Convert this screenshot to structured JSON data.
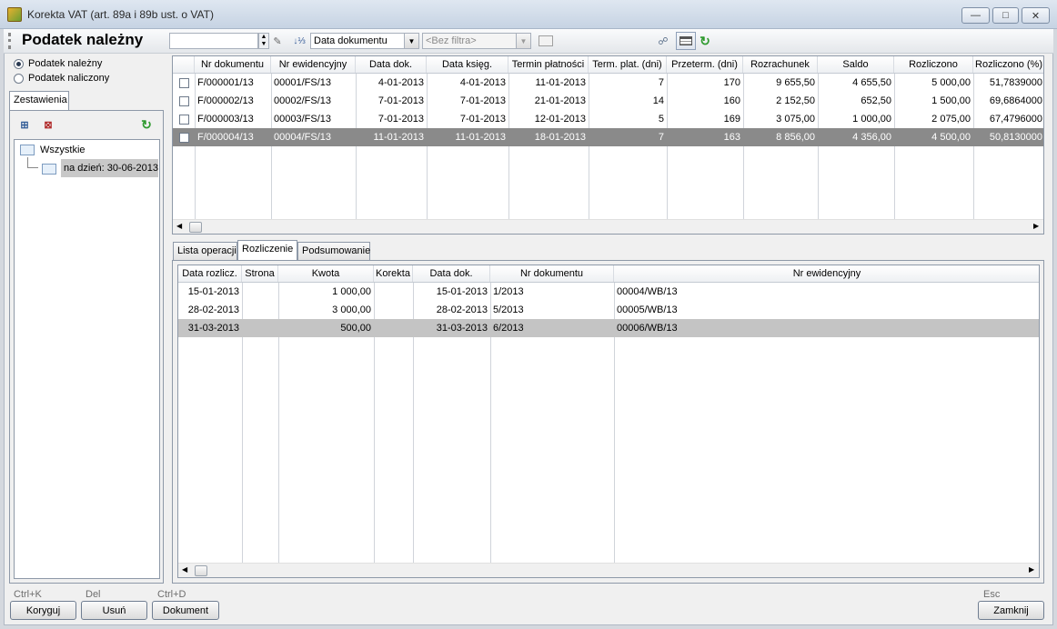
{
  "window": {
    "title": "Korekta VAT (art. 89a i 89b ust. o VAT)"
  },
  "toolbar": {
    "page_title": "Podatek należny",
    "sort_field": "Data dokumentu",
    "filter_placeholder": "<Bez filtra>"
  },
  "left": {
    "radios": [
      {
        "label": "Podatek należny",
        "checked": true
      },
      {
        "label": "Podatek naliczony",
        "checked": false
      }
    ],
    "tab_label": "Zestawienia",
    "tree": {
      "root": "Wszystkie",
      "child": "na dzień: 30-06-2013"
    }
  },
  "top_grid": {
    "headers": [
      "Nr dokumentu",
      "Nr ewidencyjny",
      "Data dok.",
      "Data księg.",
      "Termin płatności",
      "Term. plat. (dni)",
      "Przeterm. (dni)",
      "Rozrachunek",
      "Saldo",
      "Rozliczono",
      "Rozliczono (%)"
    ],
    "rows": [
      {
        "cells": [
          "F/000001/13",
          "00001/FS/13",
          "4-01-2013",
          "4-01-2013",
          "11-01-2013",
          "7",
          "170",
          "9 655,50",
          "4 655,50",
          "5 000,00",
          "51,7839000"
        ],
        "selected": false
      },
      {
        "cells": [
          "F/000002/13",
          "00002/FS/13",
          "7-01-2013",
          "7-01-2013",
          "21-01-2013",
          "14",
          "160",
          "2 152,50",
          "652,50",
          "1 500,00",
          "69,6864000"
        ],
        "selected": false
      },
      {
        "cells": [
          "F/000003/13",
          "00003/FS/13",
          "7-01-2013",
          "7-01-2013",
          "12-01-2013",
          "5",
          "169",
          "3 075,00",
          "1 000,00",
          "2 075,00",
          "67,4796000"
        ],
        "selected": false
      },
      {
        "cells": [
          "F/000004/13",
          "00004/FS/13",
          "11-01-2013",
          "11-01-2013",
          "18-01-2013",
          "7",
          "163",
          "8 856,00",
          "4 356,00",
          "4 500,00",
          "50,8130000"
        ],
        "selected": true
      }
    ]
  },
  "bottom_tabs": [
    {
      "label": "Lista operacji",
      "active": false
    },
    {
      "label": "Rozliczenie",
      "active": true
    },
    {
      "label": "Podsumowanie",
      "active": false
    }
  ],
  "bottom_grid": {
    "headers": [
      "Data rozlicz.",
      "Strona",
      "Kwota",
      "Korekta",
      "Data dok.",
      "Nr dokumentu",
      "Nr ewidencyjny"
    ],
    "rows": [
      {
        "cells": [
          "15-01-2013",
          "",
          "1 000,00",
          "",
          "15-01-2013",
          "1/2013",
          "00004/WB/13"
        ],
        "selected": false
      },
      {
        "cells": [
          "28-02-2013",
          "",
          "3 000,00",
          "",
          "28-02-2013",
          "5/2013",
          "00005/WB/13"
        ],
        "selected": false
      },
      {
        "cells": [
          "31-03-2013",
          "",
          "500,00",
          "",
          "31-03-2013",
          "6/2013",
          "00006/WB/13"
        ],
        "selected": true
      }
    ]
  },
  "footer": {
    "buttons": [
      {
        "label": "Koryguj",
        "shortcut": "Ctrl+K"
      },
      {
        "label": "Usuń",
        "shortcut": "Del"
      },
      {
        "label": "Dokument",
        "shortcut": "Ctrl+D"
      }
    ],
    "close": {
      "label": "Zamknij",
      "shortcut": "Esc"
    }
  }
}
